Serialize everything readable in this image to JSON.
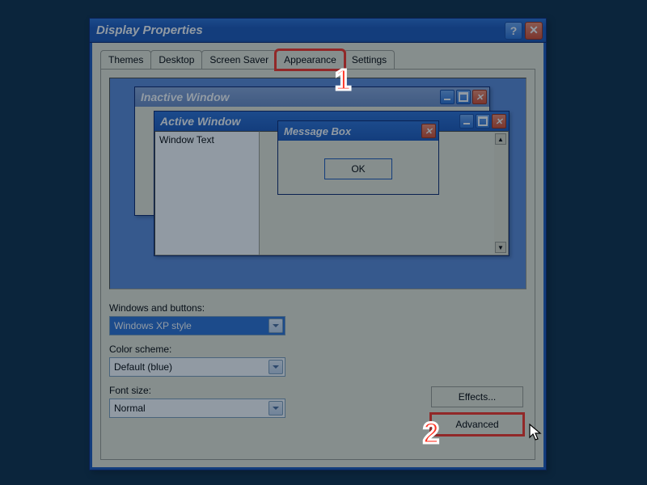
{
  "window": {
    "title": "Display Properties"
  },
  "tabs": [
    "Themes",
    "Desktop",
    "Screen Saver",
    "Appearance",
    "Settings"
  ],
  "active_tab_index": 3,
  "preview": {
    "inactive_title": "Inactive Window",
    "active_title": "Active Window",
    "window_text": "Window Text",
    "msgbox_title": "Message Box",
    "ok_label": "OK"
  },
  "labels": {
    "windows_buttons": "Windows and buttons:",
    "color_scheme": "Color scheme:",
    "font_size": "Font size:"
  },
  "combos": {
    "windows_buttons": "Windows XP style",
    "color_scheme": "Default (blue)",
    "font_size": "Normal"
  },
  "buttons": {
    "effects": "Effects...",
    "advanced": "Advanced"
  },
  "callouts": {
    "one": "1",
    "two": "2"
  }
}
